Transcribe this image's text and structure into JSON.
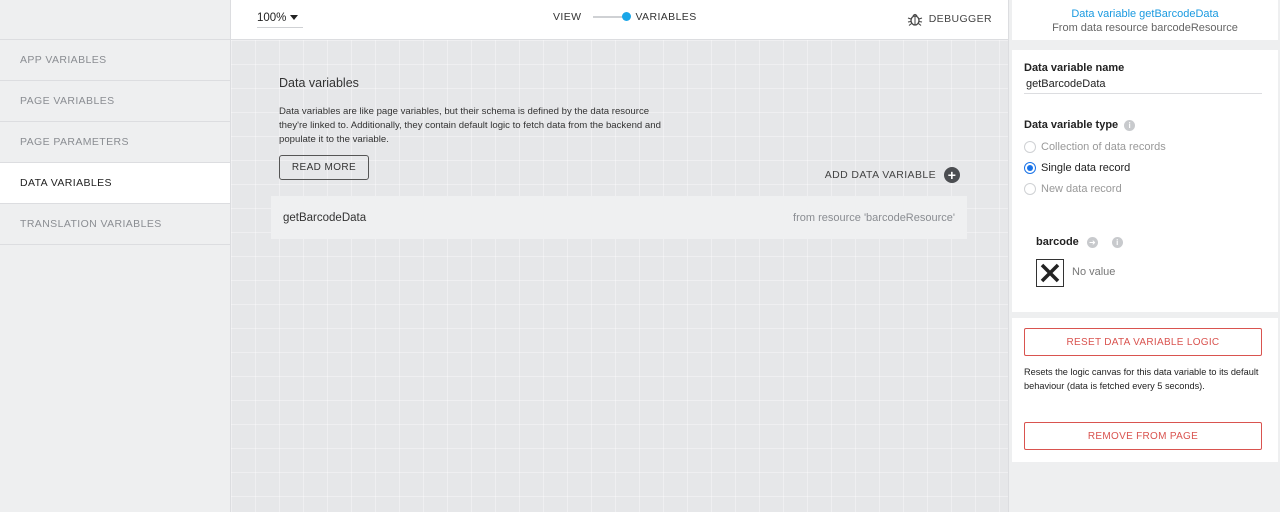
{
  "sidebar": {
    "items": [
      {
        "label": "APP VARIABLES"
      },
      {
        "label": "PAGE VARIABLES"
      },
      {
        "label": "PAGE PARAMETERS"
      },
      {
        "label": "DATA VARIABLES"
      },
      {
        "label": "TRANSLATION VARIABLES"
      }
    ],
    "active": "DATA VARIABLES"
  },
  "topbar": {
    "zoom": "100%",
    "toggle_left": "VIEW",
    "toggle_right": "VARIABLES",
    "debugger": "DEBUGGER"
  },
  "main": {
    "heading": "Data variables",
    "description": "Data variables are like page variables, but their schema is defined by the data resource they're linked to. Additionally, they contain default logic to fetch data from the backend and populate it to the variable.",
    "read_more": "READ MORE",
    "add_label": "ADD DATA VARIABLE",
    "rows": [
      {
        "name": "getBarcodeData",
        "source": "from resource 'barcodeResource'"
      }
    ]
  },
  "panel": {
    "title": "Data variable getBarcodeData",
    "subtitle": "From data resource barcodeResource",
    "name_label": "Data variable name",
    "name_value": "getBarcodeData",
    "type_label": "Data variable type",
    "types": [
      {
        "label": "Collection of data records",
        "selected": false
      },
      {
        "label": "Single data record",
        "selected": true
      },
      {
        "label": "New data record",
        "selected": false
      }
    ],
    "field_label": "barcode",
    "field_value": "No value",
    "reset_label": "RESET DATA VARIABLE LOGIC",
    "reset_desc": "Resets the logic canvas for this data variable to its default behaviour (data is fetched every 5 seconds).",
    "remove_label": "REMOVE FROM PAGE"
  },
  "colors": {
    "accent": "#1aa6e8",
    "danger": "#d9534f",
    "active_bg": "#ffffff"
  }
}
